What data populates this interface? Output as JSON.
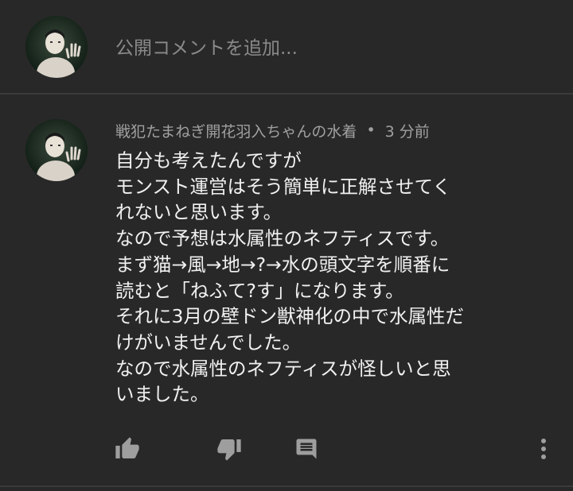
{
  "add_comment": {
    "placeholder": "公開コメントを追加..."
  },
  "comment": {
    "author": "戦犯たまねぎ開花羽入ちゃんの水着",
    "separator": "•",
    "time": "3 分前",
    "lines": [
      "自分も考えたんですが",
      "モンスト運営はそう簡単に正解させてく",
      "れないと思います。",
      "なので予想は水属性のネフティスです。",
      "まず猫→風→地→?→水の頭文字を順番に",
      "読むと「ねふて?す」になります。",
      "それに3月の壁ドン獣神化の中で水属性だ",
      "けがいませんでした。",
      "なので水属性のネフティスが怪しいと思",
      "いました。"
    ]
  },
  "actions": {
    "like_icon": "thumb-up-icon",
    "dislike_icon": "thumb-down-icon",
    "reply_icon": "reply-comment-icon",
    "more_icon": "more-vertical-icon"
  },
  "colors": {
    "background": "#282828",
    "text_primary": "#f1f1f1",
    "text_secondary": "#a0a0a0",
    "placeholder": "#8a8a8a",
    "icon": "#9e9e9e"
  }
}
